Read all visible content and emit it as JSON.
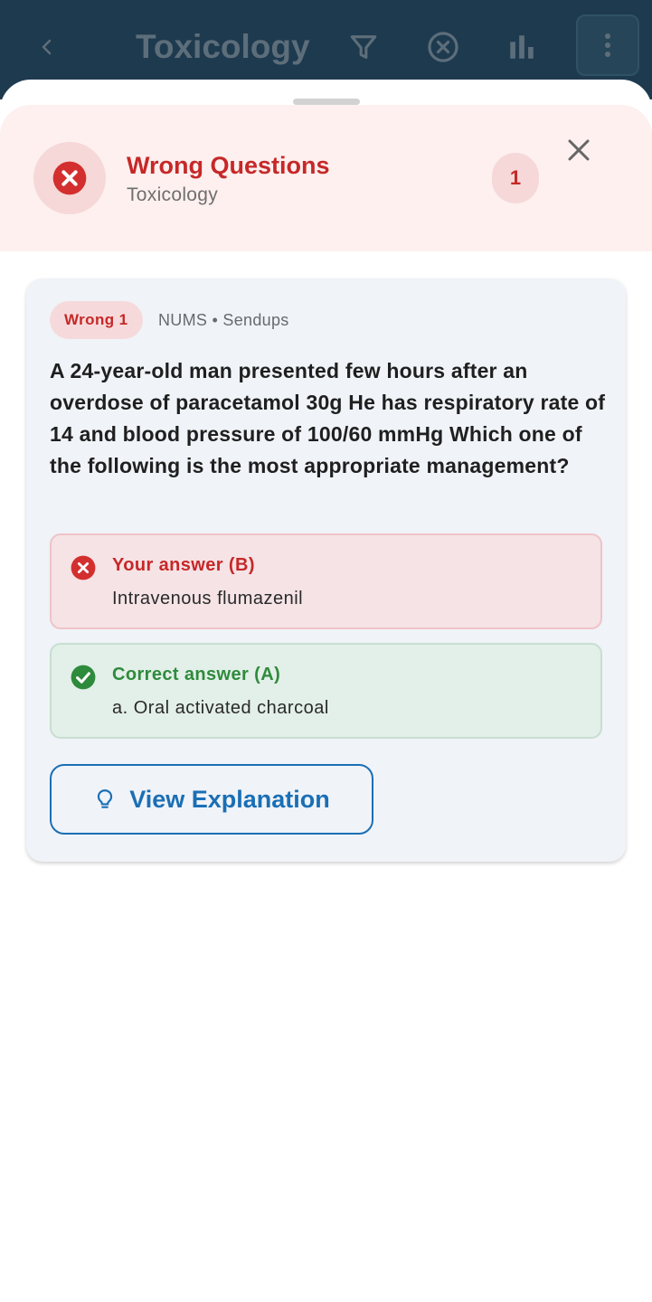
{
  "appbar": {
    "title": "Toxicology",
    "icons": {
      "back": "chevron-left-icon",
      "filter": "filter-icon",
      "cancel": "circle-x-icon",
      "stats": "bar-chart-icon",
      "more": "more-vertical-icon"
    }
  },
  "sheet": {
    "title": "Wrong Questions",
    "subtitle": "Toxicology",
    "count": "1",
    "header_icon": "circle-x-icon",
    "close_icon": "close-icon"
  },
  "question_card": {
    "tag": "Wrong 1",
    "source": "NUMS • Sendups",
    "question": "A 24-year-old man presented few hours after an overdose of paracetamol 30g He has respiratory rate of 14 and blood pressure of 100/60 mmHg Which one of the following is the most appropriate management?",
    "your_answer": {
      "label": "Your answer (B)",
      "text": "Intravenous flumazenil",
      "icon": "circle-x-icon"
    },
    "correct_answer": {
      "label": "Correct answer (A)",
      "text": "a. Oral activated charcoal",
      "icon": "check-circle-icon"
    },
    "explain_button": {
      "label": "View Explanation",
      "icon": "lightbulb-icon"
    }
  },
  "colors": {
    "appbar": "#1e3a4f",
    "error": "#c62828",
    "success": "#2e8b3c",
    "link": "#1a6fb5"
  }
}
